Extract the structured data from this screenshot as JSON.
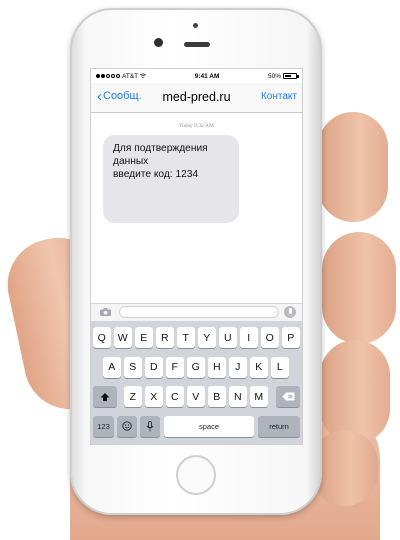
{
  "status_bar": {
    "carrier": "AT&T",
    "time": "9:41 AM",
    "battery": "50%",
    "battery_level": 0.5
  },
  "nav": {
    "back_label": "Сообщ.",
    "title": "med-pred.ru",
    "contact_label": "Контакт"
  },
  "conversation": {
    "timestamp": "Today 8:32 AM",
    "message_lines": [
      "Для подтверждения",
      "данных",
      "введите код: 1234"
    ]
  },
  "keyboard": {
    "row1": [
      "Q",
      "W",
      "E",
      "R",
      "T",
      "Y",
      "U",
      "I",
      "O",
      "P"
    ],
    "row2": [
      "A",
      "S",
      "D",
      "F",
      "G",
      "H",
      "J",
      "K",
      "L"
    ],
    "row3": [
      "Z",
      "X",
      "C",
      "V",
      "B",
      "N",
      "M"
    ],
    "numbers_key": "123",
    "space_key": "space",
    "return_key": "return"
  },
  "icons": {
    "back": "chevron-left-icon",
    "camera": "camera-icon",
    "mic": "microphone-icon",
    "shift": "shift-icon",
    "delete": "delete-icon",
    "emoji": "emoji-icon",
    "dictation": "dictation-icon"
  },
  "colors": {
    "accent": "#1a7cf5",
    "bubble": "#e5e5ea",
    "keyboard_bg": "#d1d4da"
  }
}
